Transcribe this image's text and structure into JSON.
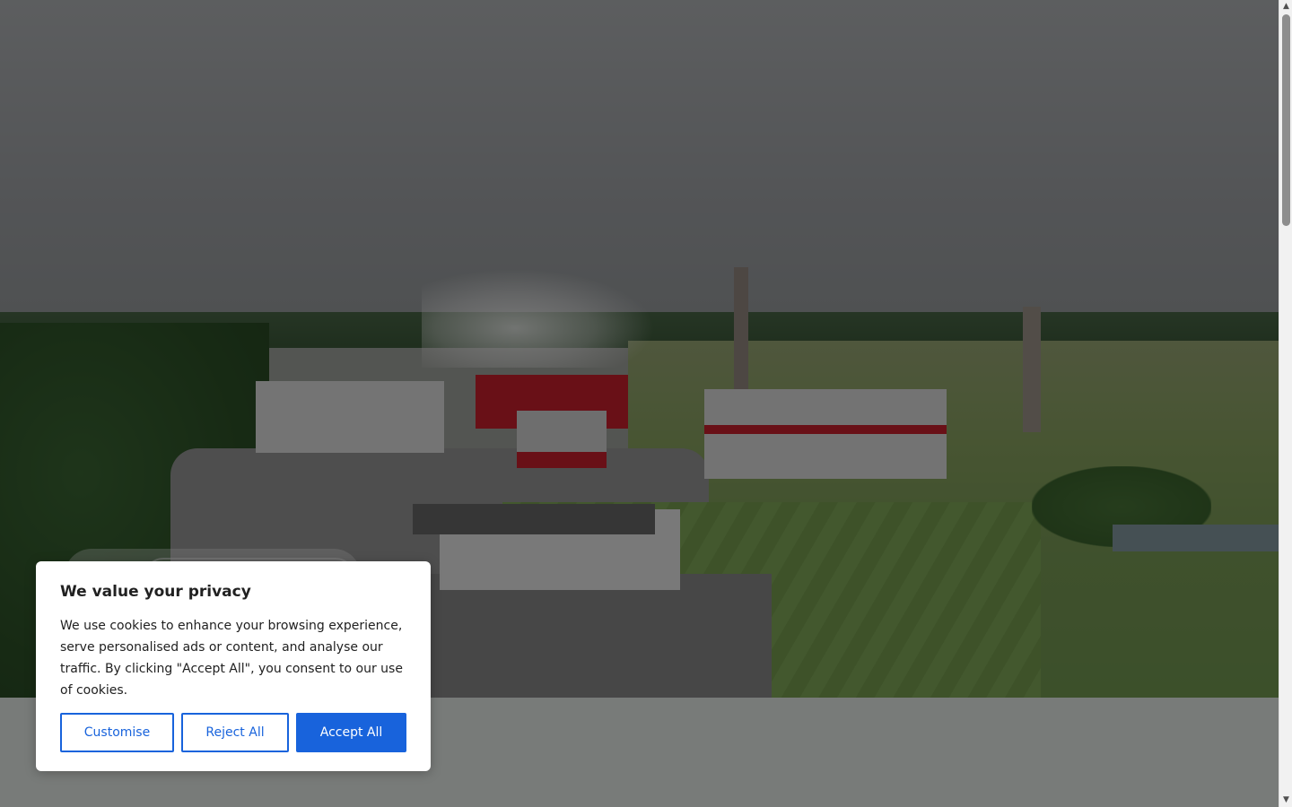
{
  "hero": {
    "image_alt_icon": "industrial-plant-aerial-photo"
  },
  "cookie_banner": {
    "title": "We value your privacy",
    "message": "We use cookies to enhance your browsing experience, serve personalised ads or content, and analyse our traffic. By clicking \"Accept All\", you consent to our use of cookies.",
    "buttons": {
      "customise": "Customise",
      "reject": "Reject All",
      "accept": "Accept All"
    }
  },
  "scrollbar": {
    "up_icon": "▲",
    "down_icon": "▼"
  },
  "colors": {
    "accent": "#1863dc",
    "page_background": "#f0f7f3",
    "overlay": "rgba(0,0,0,0.5)"
  }
}
